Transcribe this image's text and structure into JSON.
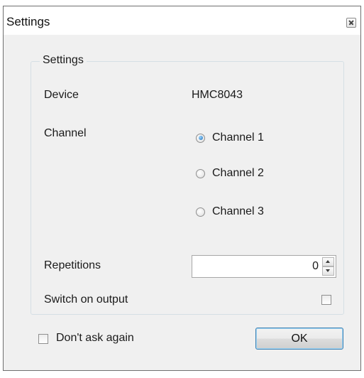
{
  "window": {
    "title": "Settings"
  },
  "group": {
    "legend": "Settings",
    "device_label": "Device",
    "device_value": "HMC8043",
    "channel_label": "Channel",
    "channels": [
      {
        "label": "Channel 1",
        "checked": true
      },
      {
        "label": "Channel 2",
        "checked": false
      },
      {
        "label": "Channel 3",
        "checked": false
      }
    ],
    "repetitions_label": "Repetitions",
    "repetitions_value": "0",
    "switch_on_output_label": "Switch on output",
    "switch_on_output_checked": false
  },
  "footer": {
    "dont_ask_label": "Don't ask again",
    "dont_ask_checked": false,
    "ok_label": "OK"
  },
  "colors": {
    "accent_border": "#3c7fb1",
    "radio_selected": "#1d6fb8",
    "dialog_background": "#f0f0f0"
  },
  "icons": {
    "close": "close-icon",
    "spin_up": "arrow-up-icon",
    "spin_down": "arrow-down-icon"
  }
}
